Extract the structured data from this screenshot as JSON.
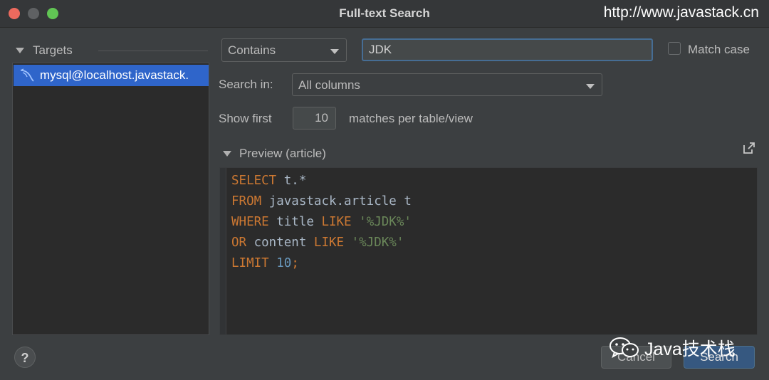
{
  "window": {
    "title": "Full-text Search",
    "watermark_url": "http://www.javastack.cn"
  },
  "targets": {
    "header": "Targets",
    "items": [
      {
        "label": "mysql@localhost.javastack.",
        "icon": "mysql-dolphin-icon",
        "selected": true
      }
    ]
  },
  "search": {
    "mode": "Contains",
    "query": "JDK",
    "match_case_label": "Match case",
    "match_case_checked": false,
    "search_in_label": "Search in:",
    "search_in_value": "All columns",
    "show_first_label": "Show first",
    "show_first_value": "10",
    "matches_label": "matches per table/view"
  },
  "preview": {
    "title": "Preview (article)",
    "lines": [
      [
        {
          "t": "SELECT",
          "c": "kw"
        },
        {
          "t": " t.*",
          "c": "id"
        }
      ],
      [
        {
          "t": "FROM",
          "c": "kw"
        },
        {
          "t": " javastack.article t",
          "c": "id"
        }
      ],
      [
        {
          "t": "WHERE",
          "c": "kw"
        },
        {
          "t": " title ",
          "c": "id"
        },
        {
          "t": "LIKE",
          "c": "kw"
        },
        {
          "t": " ",
          "c": "id"
        },
        {
          "t": "'%JDK%'",
          "c": "str"
        }
      ],
      [
        {
          "t": "OR",
          "c": "kw"
        },
        {
          "t": " content ",
          "c": "id"
        },
        {
          "t": "LIKE",
          "c": "kw"
        },
        {
          "t": " ",
          "c": "id"
        },
        {
          "t": "'%JDK%'",
          "c": "str"
        }
      ],
      [
        {
          "t": "LIMIT",
          "c": "kw"
        },
        {
          "t": " ",
          "c": "id"
        },
        {
          "t": "10",
          "c": "num"
        },
        {
          "t": ";",
          "c": "kw"
        }
      ]
    ]
  },
  "buttons": {
    "help": "?",
    "cancel": "Cancel",
    "search": "Search"
  },
  "watermark_brand": "Java技术栈",
  "colors": {
    "keyword": "#cc7832",
    "string": "#6a8759",
    "number": "#6897bb",
    "identifier": "#a9b7c6",
    "selection": "#2f65ca",
    "primary_button": "#365880"
  }
}
